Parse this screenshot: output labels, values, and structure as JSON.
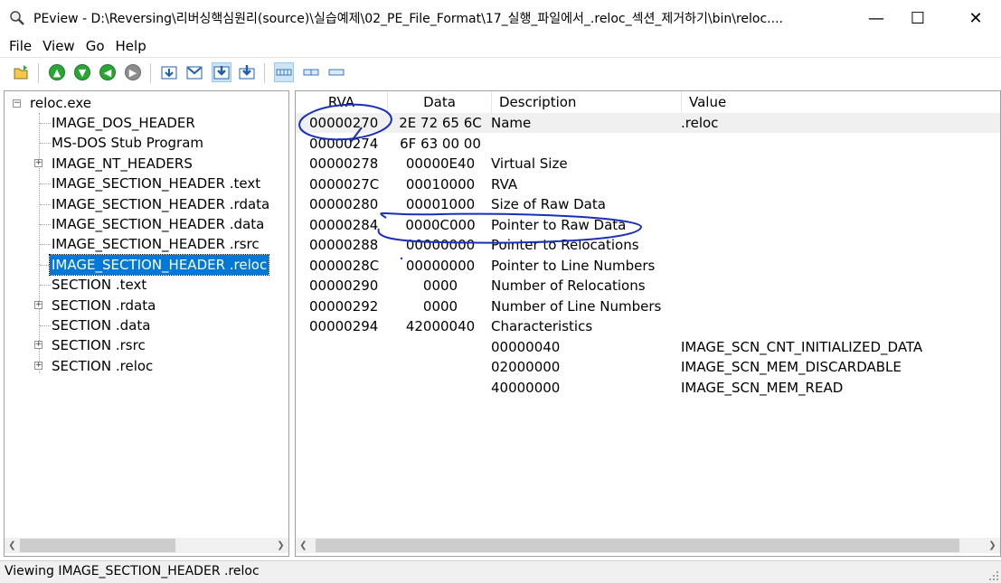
{
  "window": {
    "app_name": "PEview",
    "title": "PEview - D:\\Reversing\\리버싱핵심원리(source)\\실습예제\\02_PE_File_Format\\17_실행_파일에서_.reloc_섹션_제거하기\\bin\\reloc....",
    "minimize": "—",
    "maximize": "☐",
    "close": "✕"
  },
  "menu": [
    "File",
    "View",
    "Go",
    "Help"
  ],
  "tree": {
    "root": "reloc.exe",
    "items": [
      {
        "label": "IMAGE_DOS_HEADER",
        "expandable": false
      },
      {
        "label": "MS-DOS Stub Program",
        "expandable": false
      },
      {
        "label": "IMAGE_NT_HEADERS",
        "expandable": true
      },
      {
        "label": "IMAGE_SECTION_HEADER .text",
        "expandable": false
      },
      {
        "label": "IMAGE_SECTION_HEADER .rdata",
        "expandable": false
      },
      {
        "label": "IMAGE_SECTION_HEADER .data",
        "expandable": false
      },
      {
        "label": "IMAGE_SECTION_HEADER .rsrc",
        "expandable": false
      },
      {
        "label": "IMAGE_SECTION_HEADER .reloc",
        "expandable": false,
        "selected": true
      },
      {
        "label": "SECTION .text",
        "expandable": false
      },
      {
        "label": "SECTION .rdata",
        "expandable": true
      },
      {
        "label": "SECTION .data",
        "expandable": false
      },
      {
        "label": "SECTION .rsrc",
        "expandable": true
      },
      {
        "label": "SECTION .reloc",
        "expandable": true
      }
    ]
  },
  "table": {
    "headers": {
      "rva": "RVA",
      "data": "Data",
      "description": "Description",
      "value": "Value"
    },
    "rows": [
      {
        "rva": "00000270",
        "data": "2E  72  65  6C",
        "description": "Name",
        "value": ".reloc"
      },
      {
        "rva": "00000274",
        "data": "6F  63  00  00",
        "description": "",
        "value": ""
      },
      {
        "rva": "00000278",
        "data": "00000E40",
        "description": "Virtual Size",
        "value": ""
      },
      {
        "rva": "0000027C",
        "data": "00010000",
        "description": "RVA",
        "value": ""
      },
      {
        "rva": "00000280",
        "data": "00001000",
        "description": "Size of Raw Data",
        "value": ""
      },
      {
        "rva": "00000284",
        "data": "0000C000",
        "description": "Pointer to Raw Data",
        "value": ""
      },
      {
        "rva": "00000288",
        "data": "00000000",
        "description": "Pointer to Relocations",
        "value": ""
      },
      {
        "rva": "0000028C",
        "data": "00000000",
        "description": "Pointer to Line Numbers",
        "value": ""
      },
      {
        "rva": "00000290",
        "data": "0000",
        "description": "Number of Relocations",
        "value": ""
      },
      {
        "rva": "00000292",
        "data": "0000",
        "description": "Number of Line Numbers",
        "value": ""
      },
      {
        "rva": "00000294",
        "data": "42000040",
        "description": "Characteristics",
        "value": ""
      },
      {
        "rva": "",
        "data": "",
        "description": "00000040",
        "value": "IMAGE_SCN_CNT_INITIALIZED_DATA"
      },
      {
        "rva": "",
        "data": "",
        "description": "02000000",
        "value": "IMAGE_SCN_MEM_DISCARDABLE"
      },
      {
        "rva": "",
        "data": "",
        "description": "40000000",
        "value": "IMAGE_SCN_MEM_READ"
      }
    ]
  },
  "annotation_color": "#1a2fb8",
  "status": "Viewing IMAGE_SECTION_HEADER .reloc",
  "toolbar_icons": [
    "open-file-icon",
    "go-up-icon",
    "go-down-icon",
    "go-back-icon",
    "go-forward-icon",
    "view-1-icon",
    "view-2-icon",
    "view-3-icon",
    "view-4-icon",
    "layout-wide-icon",
    "layout-medium-icon",
    "layout-narrow-icon"
  ]
}
